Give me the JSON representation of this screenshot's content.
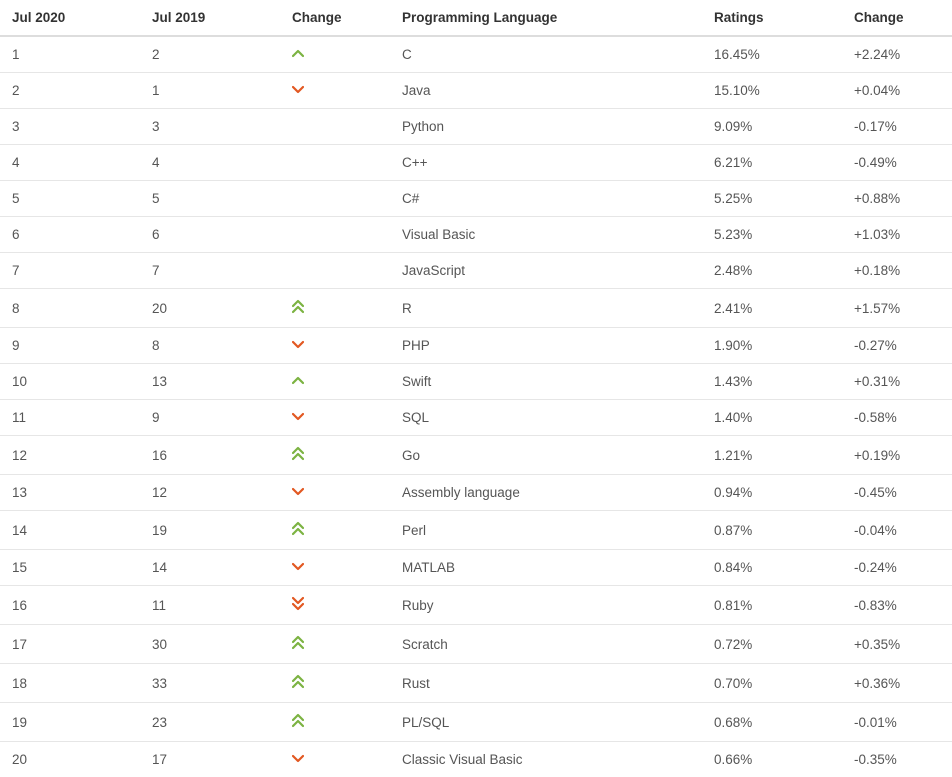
{
  "headers": {
    "jul2020": "Jul 2020",
    "jul2019": "Jul 2019",
    "changeIcon": "Change",
    "language": "Programming Language",
    "ratings": "Ratings",
    "changePct": "Change"
  },
  "rows": [
    {
      "jul2020": "1",
      "jul2019": "2",
      "changeIcon": "up-single",
      "language": "C",
      "ratings": "16.45%",
      "changePct": "+2.24%"
    },
    {
      "jul2020": "2",
      "jul2019": "1",
      "changeIcon": "down-single",
      "language": "Java",
      "ratings": "15.10%",
      "changePct": "+0.04%"
    },
    {
      "jul2020": "3",
      "jul2019": "3",
      "changeIcon": "",
      "language": "Python",
      "ratings": "9.09%",
      "changePct": "-0.17%"
    },
    {
      "jul2020": "4",
      "jul2019": "4",
      "changeIcon": "",
      "language": "C++",
      "ratings": "6.21%",
      "changePct": "-0.49%"
    },
    {
      "jul2020": "5",
      "jul2019": "5",
      "changeIcon": "",
      "language": "C#",
      "ratings": "5.25%",
      "changePct": "+0.88%"
    },
    {
      "jul2020": "6",
      "jul2019": "6",
      "changeIcon": "",
      "language": "Visual Basic",
      "ratings": "5.23%",
      "changePct": "+1.03%"
    },
    {
      "jul2020": "7",
      "jul2019": "7",
      "changeIcon": "",
      "language": "JavaScript",
      "ratings": "2.48%",
      "changePct": "+0.18%"
    },
    {
      "jul2020": "8",
      "jul2019": "20",
      "changeIcon": "up-double",
      "language": "R",
      "ratings": "2.41%",
      "changePct": "+1.57%"
    },
    {
      "jul2020": "9",
      "jul2019": "8",
      "changeIcon": "down-single",
      "language": "PHP",
      "ratings": "1.90%",
      "changePct": "-0.27%"
    },
    {
      "jul2020": "10",
      "jul2019": "13",
      "changeIcon": "up-single",
      "language": "Swift",
      "ratings": "1.43%",
      "changePct": "+0.31%"
    },
    {
      "jul2020": "11",
      "jul2019": "9",
      "changeIcon": "down-single",
      "language": "SQL",
      "ratings": "1.40%",
      "changePct": "-0.58%"
    },
    {
      "jul2020": "12",
      "jul2019": "16",
      "changeIcon": "up-double",
      "language": "Go",
      "ratings": "1.21%",
      "changePct": "+0.19%"
    },
    {
      "jul2020": "13",
      "jul2019": "12",
      "changeIcon": "down-single",
      "language": "Assembly language",
      "ratings": "0.94%",
      "changePct": "-0.45%"
    },
    {
      "jul2020": "14",
      "jul2019": "19",
      "changeIcon": "up-double",
      "language": "Perl",
      "ratings": "0.87%",
      "changePct": "-0.04%"
    },
    {
      "jul2020": "15",
      "jul2019": "14",
      "changeIcon": "down-single",
      "language": "MATLAB",
      "ratings": "0.84%",
      "changePct": "-0.24%"
    },
    {
      "jul2020": "16",
      "jul2019": "11",
      "changeIcon": "down-double",
      "language": "Ruby",
      "ratings": "0.81%",
      "changePct": "-0.83%"
    },
    {
      "jul2020": "17",
      "jul2019": "30",
      "changeIcon": "up-double",
      "language": "Scratch",
      "ratings": "0.72%",
      "changePct": "+0.35%"
    },
    {
      "jul2020": "18",
      "jul2019": "33",
      "changeIcon": "up-double",
      "language": "Rust",
      "ratings": "0.70%",
      "changePct": "+0.36%"
    },
    {
      "jul2020": "19",
      "jul2019": "23",
      "changeIcon": "up-double",
      "language": "PL/SQL",
      "ratings": "0.68%",
      "changePct": "-0.01%"
    },
    {
      "jul2020": "20",
      "jul2019": "17",
      "changeIcon": "down-single",
      "language": "Classic Visual Basic",
      "ratings": "0.66%",
      "changePct": "-0.35%"
    }
  ]
}
